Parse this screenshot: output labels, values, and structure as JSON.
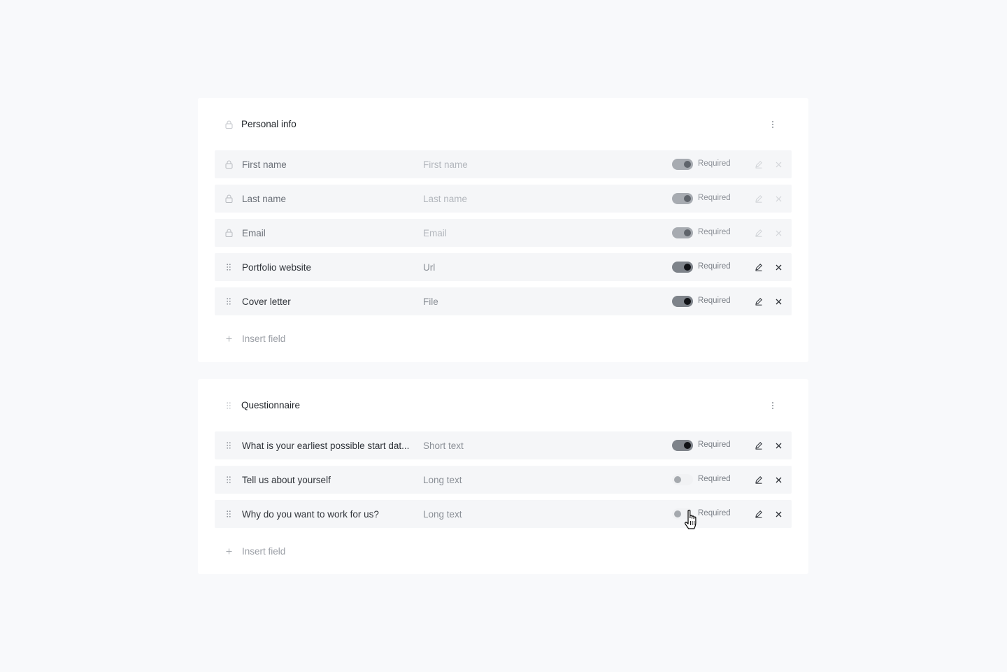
{
  "sections": [
    {
      "title": "Personal info",
      "header_icon": "lock-icon",
      "fields": [
        {
          "label": "First name",
          "type": "First name",
          "required": true,
          "required_label": "Required",
          "locked": true
        },
        {
          "label": "Last name",
          "type": "Last name",
          "required": true,
          "required_label": "Required",
          "locked": true
        },
        {
          "label": "Email",
          "type": "Email",
          "required": true,
          "required_label": "Required",
          "locked": true
        },
        {
          "label": "Portfolio website",
          "type": "Url",
          "required": true,
          "required_label": "Required",
          "locked": false
        },
        {
          "label": "Cover letter",
          "type": "File",
          "required": true,
          "required_label": "Required",
          "locked": false
        }
      ],
      "insert_label": "Insert field"
    },
    {
      "title": "Questionnaire",
      "header_icon": "drag-handle-icon",
      "fields": [
        {
          "label": "What is your earliest possible start dat...",
          "type": "Short text",
          "required": true,
          "required_label": "Required",
          "locked": false
        },
        {
          "label": "Tell us about yourself",
          "type": "Long text",
          "required": false,
          "required_label": "Required",
          "locked": false
        },
        {
          "label": "Why do you want to work for us?",
          "type": "Long text",
          "required": false,
          "required_label": "Required",
          "locked": false
        }
      ],
      "insert_label": "Insert field"
    }
  ],
  "icons": {
    "lock": "lock-icon",
    "drag": "drag-handle-icon",
    "edit": "pencil-icon",
    "delete": "close-icon",
    "more": "more-vertical-icon",
    "add": "plus-icon"
  },
  "colors": {
    "background": "#f8f9fb",
    "card": "#ffffff",
    "row": "#f5f6f8",
    "toggle_on_knob": "#101216",
    "toggle_on_track": "#7e838a"
  }
}
